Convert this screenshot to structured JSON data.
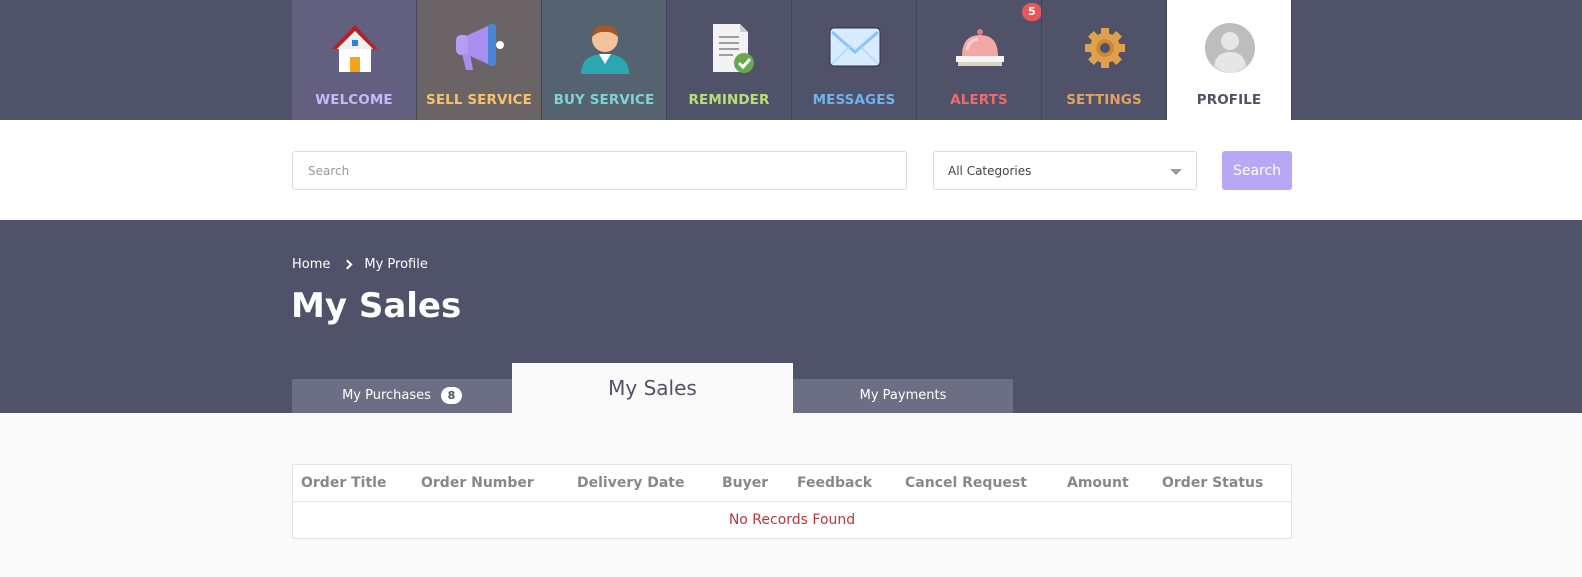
{
  "nav": {
    "items": [
      {
        "label": "WELCOME",
        "color": "#c5b8ff",
        "bg": "#63607f",
        "icon": "home-icon"
      },
      {
        "label": "SELL SERVICE",
        "color": "#f5c36b",
        "bg": "#6b6467",
        "icon": "megaphone-icon"
      },
      {
        "label": "BUY SERVICE",
        "color": "#7fd3d6",
        "bg": "#55626f",
        "icon": "user-icon"
      },
      {
        "label": "REMINDER",
        "color": "#b4e07a",
        "bg": "#4f5268",
        "icon": "document-check-icon"
      },
      {
        "label": "MESSAGES",
        "color": "#6fb2ef",
        "bg": "#4f5268",
        "icon": "envelope-icon"
      },
      {
        "label": "ALERTS",
        "color": "#ea6c6c",
        "bg": "#4f5268",
        "icon": "bell-icon",
        "badge": "5"
      },
      {
        "label": "SETTINGS",
        "color": "#e2a25f",
        "bg": "#4f5268",
        "icon": "gear-icon"
      },
      {
        "label": "PROFILE",
        "color": "#4f5268",
        "bg": "#ffffff",
        "icon": "avatar-icon"
      }
    ]
  },
  "search": {
    "placeholder": "Search",
    "category": "All Categories",
    "button": "Search"
  },
  "breadcrumb": {
    "home": "Home",
    "current": "My Profile"
  },
  "page_title": "My Sales",
  "tabs": [
    {
      "label": "My Purchases",
      "count": "8"
    },
    {
      "label": "My Sales"
    },
    {
      "label": "My Payments"
    }
  ],
  "table": {
    "columns": [
      "Order Title",
      "Order Number",
      "Delivery Date",
      "Buyer",
      "Feedback",
      "Cancel Request",
      "Amount",
      "Order Status"
    ],
    "empty_message": "No Records Found"
  }
}
